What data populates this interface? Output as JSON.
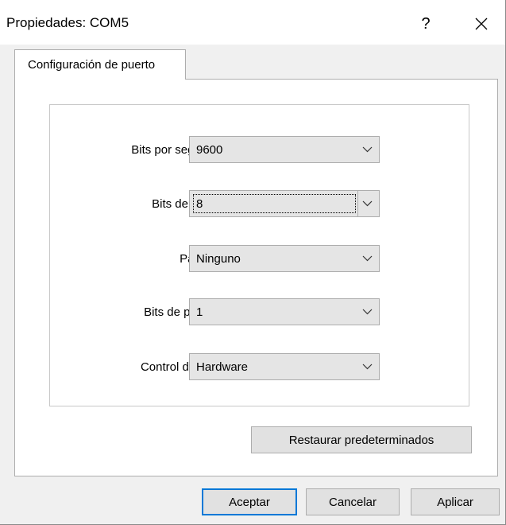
{
  "window": {
    "title": "Propiedades: COM5",
    "help_label": "?"
  },
  "tabs": [
    {
      "label": "Configuración de puerto",
      "selected": true
    }
  ],
  "port_settings": {
    "bits_per_second": {
      "label": "Bits por segundo:",
      "value": "9600"
    },
    "data_bits": {
      "label": "Bits de datos:",
      "value": "8"
    },
    "parity": {
      "label": "Paridad:",
      "value": "Ninguno"
    },
    "stop_bits": {
      "label": "Bits de parada:",
      "value": "1"
    },
    "flow_control": {
      "label": "Control de flujo:",
      "value": "Hardware"
    }
  },
  "restore_defaults_label": "Restaurar predeterminados",
  "footer": {
    "ok_label": "Aceptar",
    "cancel_label": "Cancelar",
    "apply_label": "Aplicar"
  },
  "colors": {
    "focus_border": "#0078d7",
    "window_bg": "#f0f0f0",
    "panel_bg": "#ffffff"
  },
  "icons": {
    "close": "close-icon",
    "dropdown": "chevron-down-icon"
  }
}
